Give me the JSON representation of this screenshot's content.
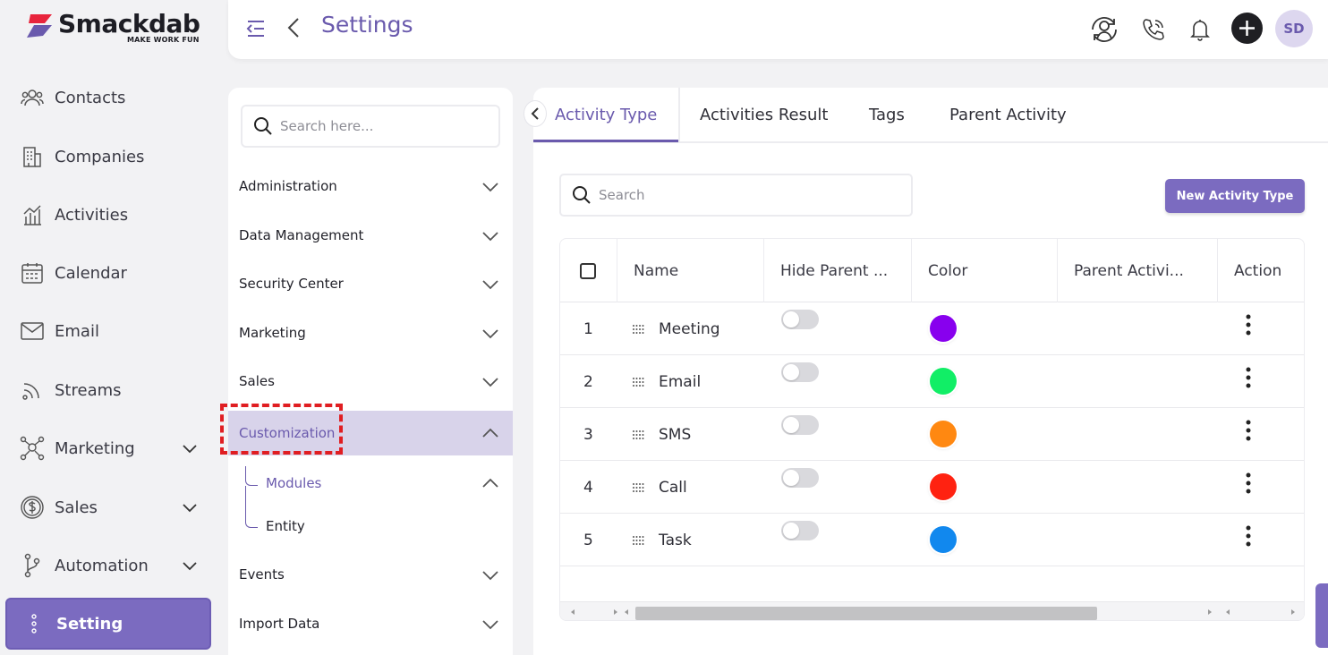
{
  "brand": {
    "name": "Smackdab",
    "tagline": "MAKE WORK FUN",
    "accent": "#6a5aad"
  },
  "sidebar": {
    "items": [
      {
        "label": "Contacts",
        "icon": "users-icon"
      },
      {
        "label": "Companies",
        "icon": "building-icon"
      },
      {
        "label": "Activities",
        "icon": "activity-chart-icon"
      },
      {
        "label": "Calendar",
        "icon": "calendar-icon"
      },
      {
        "label": "Email",
        "icon": "mail-icon"
      },
      {
        "label": "Streams",
        "icon": "rss-icon"
      },
      {
        "label": "Marketing",
        "icon": "network-icon"
      },
      {
        "label": "Sales",
        "icon": "dollar-icon"
      },
      {
        "label": "Automation",
        "icon": "branch-icon"
      },
      {
        "label": "Setting",
        "icon": "dots-vertical-icon"
      }
    ]
  },
  "header": {
    "title": "Settings",
    "avatar_initials": "SD"
  },
  "settings_menu": {
    "search_placeholder": "Search here...",
    "items": [
      "Administration",
      "Data Management",
      "Security Center",
      "Marketing",
      "Sales",
      "Customization",
      "Events",
      "Import Data"
    ],
    "sub_items": [
      "Modules",
      "Entity"
    ]
  },
  "tabs": [
    "Activity Type",
    "Activities Result",
    "Tags",
    "Parent Activity"
  ],
  "toolbar": {
    "search_placeholder": "Search",
    "new_button": "New Activity Type"
  },
  "table": {
    "columns": [
      "Name",
      "Hide Parent ...",
      "Color",
      "Parent Activi...",
      "Action"
    ],
    "rows": [
      {
        "index": "1",
        "name": "Meeting",
        "color": "#8800ee",
        "hidden": false
      },
      {
        "index": "2",
        "name": "Email",
        "color": "#11ee66",
        "hidden": false
      },
      {
        "index": "3",
        "name": "SMS",
        "color": "#ff8811",
        "hidden": false
      },
      {
        "index": "4",
        "name": "Call",
        "color": "#ff2211",
        "hidden": false
      },
      {
        "index": "5",
        "name": "Task",
        "color": "#1188ee",
        "hidden": false
      }
    ]
  }
}
